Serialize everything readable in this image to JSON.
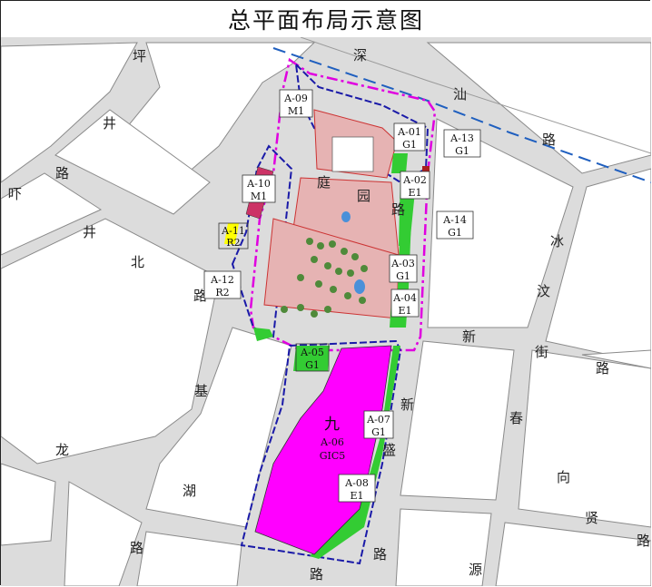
{
  "title": "总平面布局示意图",
  "colors": {
    "road": "#dcdcdc",
    "block": "#ffffff",
    "magenta": "#ff00ff",
    "green": "#33cc33",
    "residential_pink": "#e6b3b3",
    "yellow": "#ffff00",
    "boundary_magenta": "#e000e0",
    "boundary_blue": "#1a1aa8",
    "metro_blue": "#1f5fbf"
  },
  "road_labels": [
    {
      "name": "shennan-road",
      "chars": [
        "深",
        "汕",
        "路"
      ]
    },
    {
      "name": "pingjing-road",
      "chars": [
        "坪",
        "井",
        "路"
      ]
    },
    {
      "name": "tingjing-north-road",
      "chars": [
        "吓",
        "井",
        "北",
        "路"
      ]
    },
    {
      "name": "tingyuan-road",
      "chars": [
        "庭",
        "园",
        "路"
      ]
    },
    {
      "name": "xinhe-road",
      "chars": [
        "新",
        "街",
        "路"
      ]
    },
    {
      "name": "pingjing-road-east",
      "chars": [
        "冰",
        "汶"
      ]
    },
    {
      "name": "xinsheng-road",
      "chars": [
        "新",
        "盛",
        "路"
      ]
    },
    {
      "name": "jilong-road",
      "chars": [
        "基",
        "龙",
        "湖",
        "路"
      ]
    },
    {
      "name": "chunxiang-road",
      "chars": [
        "春",
        "向",
        "贤",
        "路"
      ]
    },
    {
      "name": "yuan-road",
      "chars": [
        "源",
        "路"
      ]
    }
  ],
  "plots": [
    {
      "code": "A-09",
      "use": "M1"
    },
    {
      "code": "A-01",
      "use": "G1"
    },
    {
      "code": "A-13",
      "use": "G1"
    },
    {
      "code": "A-02",
      "use": "E1"
    },
    {
      "code": "A-10",
      "use": "M1"
    },
    {
      "code": "A-14",
      "use": "G1"
    },
    {
      "code": "A-11",
      "use": "R2"
    },
    {
      "code": "A-03",
      "use": "G1"
    },
    {
      "code": "A-12",
      "use": "R2"
    },
    {
      "code": "A-04",
      "use": "E1"
    },
    {
      "code": "A-05",
      "use": "G1"
    },
    {
      "code": "A-07",
      "use": "G1"
    },
    {
      "code": "A-06",
      "use": "GIC5"
    },
    {
      "code": "A-08",
      "use": "E1"
    }
  ],
  "block_mark": "九"
}
